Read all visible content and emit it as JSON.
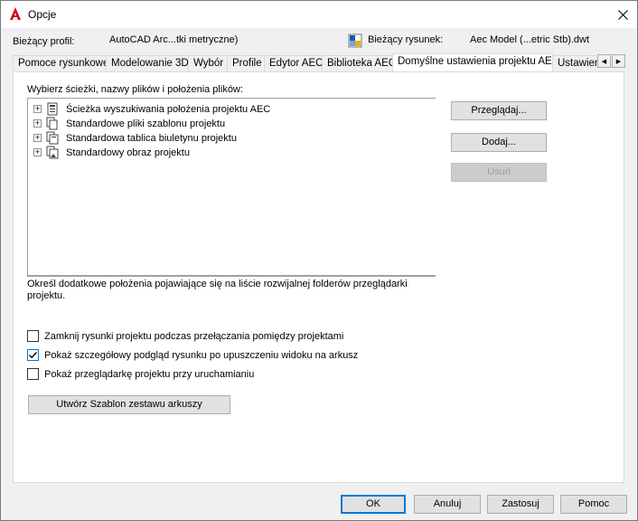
{
  "window": {
    "title": "Opcje",
    "close_glyph": "✕"
  },
  "profile": {
    "label": "Bieżący profil:",
    "value": "AutoCAD Arc...tki metryczne)",
    "drawing_label": "Bieżący rysunek:",
    "drawing_value": "Aec Model (...etric Stb).dwt"
  },
  "tabs": [
    {
      "label": "Pomoce rysunkowe",
      "active": false
    },
    {
      "label": "Modelowanie 3D",
      "active": false
    },
    {
      "label": "Wybór",
      "active": false
    },
    {
      "label": "Profile",
      "active": false
    },
    {
      "label": "Edytor AEC",
      "active": false
    },
    {
      "label": "Biblioteka AEC",
      "active": false
    },
    {
      "label": "Domyślne ustawienia projektu AEC",
      "active": true
    },
    {
      "label": "Ustawien",
      "active": false
    }
  ],
  "tab_scroll": {
    "left": "◀",
    "right": "▶"
  },
  "paths": {
    "label": "Wybierz ścieżki, nazwy plików i położenia plików:",
    "items": [
      {
        "label": "Ścieżka wyszukiwania położenia projektu AEC",
        "icon": "project-file-icon",
        "expander": "+"
      },
      {
        "label": "Standardowe pliki szablonu projektu",
        "icon": "template-files-icon",
        "expander": "+"
      },
      {
        "label": "Standardowa tablica biuletynu projektu",
        "icon": "bulletin-files-icon",
        "expander": "+"
      },
      {
        "label": "Standardowy obraz projektu",
        "icon": "image-files-icon",
        "expander": "+"
      }
    ],
    "description": "Określ dodatkowe położenia pojawiające się na liście rozwijalnej folderów przeglądarki projektu."
  },
  "side_buttons": {
    "browse": "Przeglądaj...",
    "add": "Dodaj...",
    "remove": "Usuń"
  },
  "checkboxes": [
    {
      "label": "Zamknij rysunki projektu podczas przełączania pomiędzy projektami",
      "checked": false
    },
    {
      "label": "Pokaż szczegółowy podgląd rysunku po upuszczeniu widoku na arkusz",
      "checked": true
    },
    {
      "label": "Pokaż przeglądarkę projektu przy uruchamianiu",
      "checked": false
    }
  ],
  "template_button": "Utwórz Szablon zestawu arkuszy",
  "footer": {
    "ok": "OK",
    "cancel": "Anuluj",
    "apply": "Zastosuj",
    "help": "Pomoc"
  },
  "colors": {
    "accent": "#0078d7",
    "autocad_red": "#d6001c"
  }
}
